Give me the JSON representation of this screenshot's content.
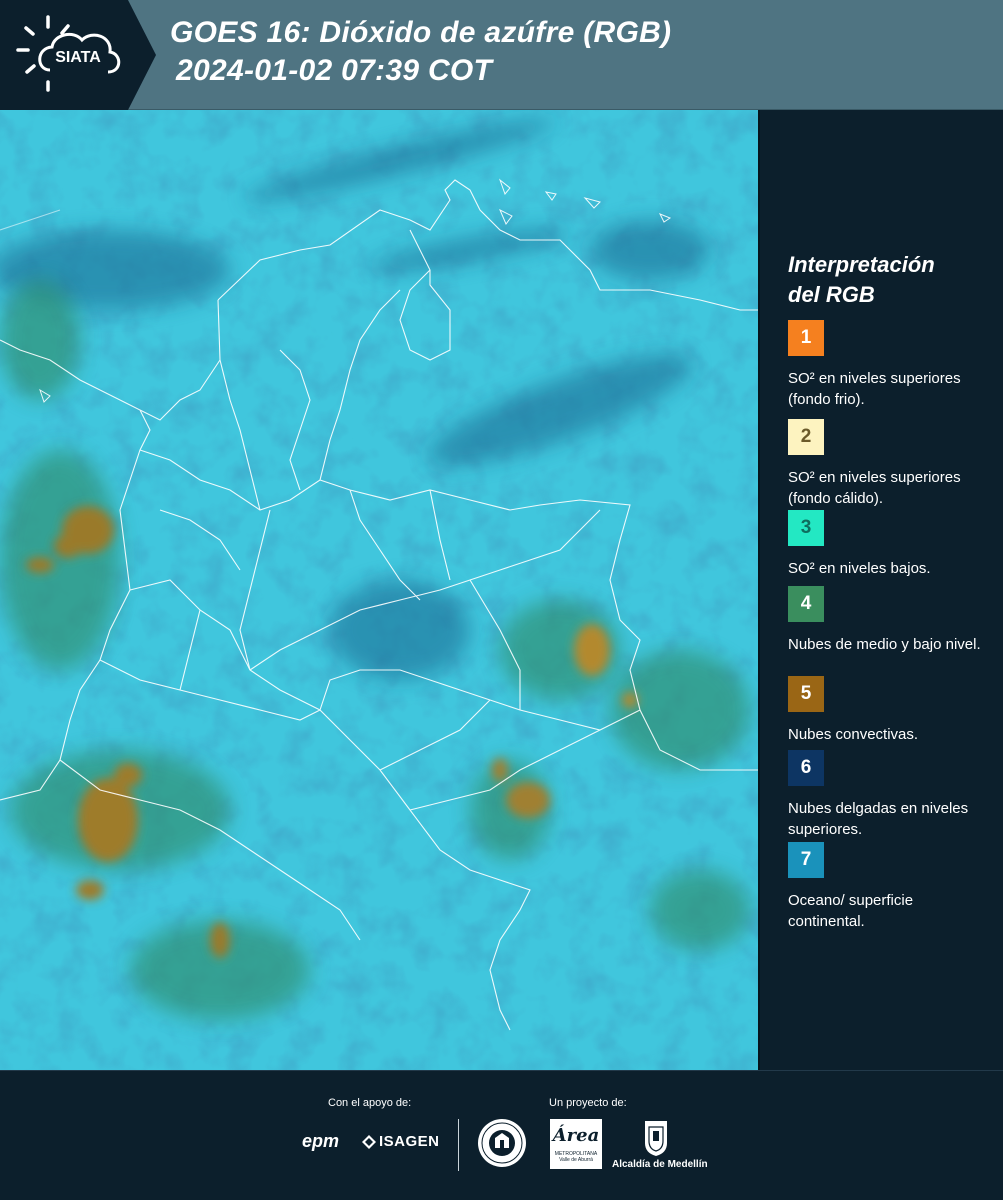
{
  "header": {
    "logo_text": "SIATA",
    "title_line1": "GOES 16: Dióxido de azúfre (RGB)",
    "title_line2": "2024-01-02 07:39 COT"
  },
  "legend": {
    "title_line1": "Interpretación",
    "title_line2": "del RGB",
    "items": [
      {
        "number": "1",
        "color": "#f5801f",
        "text_color": "#ffffff",
        "description": "SO² en niveles superiores (fondo frio)."
      },
      {
        "number": "2",
        "color": "#fdf3c0",
        "text_color": "#6b5a2a",
        "description": "SO² en niveles superiores (fondo cálido)."
      },
      {
        "number": "3",
        "color": "#23e8c3",
        "text_color": "#0e6e5e",
        "description": "SO² en niveles bajos."
      },
      {
        "number": "4",
        "color": "#3a8e5e",
        "text_color": "#ffffff",
        "description": "Nubes de medio y bajo nivel."
      },
      {
        "number": "5",
        "color": "#9a6615",
        "text_color": "#ffffff",
        "description": "Nubes convectivas."
      },
      {
        "number": "6",
        "color": "#0d3563",
        "text_color": "#ffffff",
        "description": "Nubes delgadas en niveles superiores."
      },
      {
        "number": "7",
        "color": "#1a92bb",
        "text_color": "#ffffff",
        "description": "Oceano/ superficie continental."
      }
    ]
  },
  "footer": {
    "support_label": "Con el apoyo de:",
    "project_label": "Un proyecto de:",
    "epm": "epm",
    "isagen": "ISAGEN",
    "area_word": "Área",
    "area_sub": "METROPOLITANA Valle de Aburrá",
    "alcaldia": "Alcaldía de Medellín"
  }
}
